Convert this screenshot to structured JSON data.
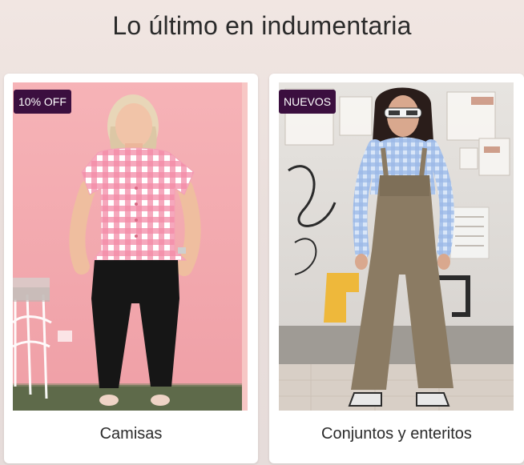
{
  "section": {
    "title": "Lo último en indumentaria"
  },
  "products": [
    {
      "badge": "10% OFF",
      "caption": "Camisas",
      "image_icon": "woman-gingham-blouse-photo"
    },
    {
      "badge": "NUEVOS",
      "caption": "Conjuntos y enteritos",
      "image_icon": "woman-overalls-photo"
    }
  ],
  "colors": {
    "badge_bg": "#3b0f3f",
    "badge_text": "#ffffff",
    "card_bg": "#ffffff"
  }
}
